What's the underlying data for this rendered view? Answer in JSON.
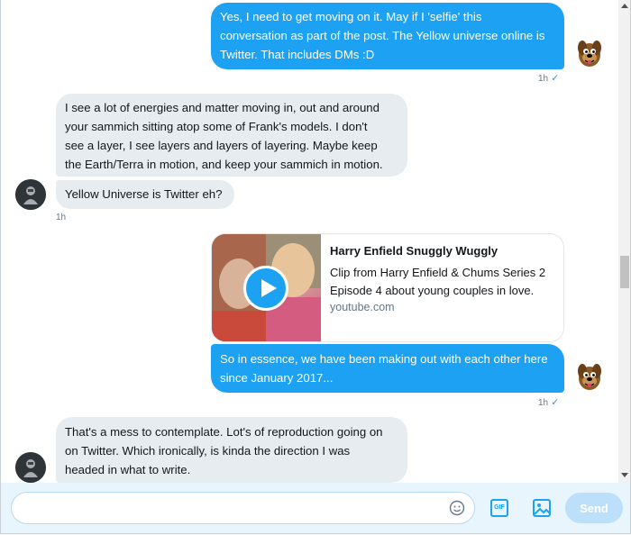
{
  "messages": {
    "m1": {
      "line1": "Yes, I need to get moving on it. May if I 'selfie' this",
      "line2": "conversation as part of the post. The Yellow universe online is",
      "line3": "Twitter. That includes DMs :D",
      "time": "1h",
      "check": "✓"
    },
    "m2": {
      "line1": "I see a lot of energies and matter moving in, out and around",
      "line2": "your sammich sitting atop some of Frank's models. I don't",
      "line3": "see a layer, I see layers and layers of layering. Maybe keep",
      "line4": "the Earth/Terra in motion, and keep your sammich in motion."
    },
    "m3": {
      "line1": "Yellow Universe is Twitter eh?",
      "time": "1h"
    },
    "card": {
      "title": "Harry Enfield Snuggly Wuggly",
      "desc": "Clip from Harry Enfield & Chums Series 2 Episode 4 about young couples in love.",
      "domain": "youtube.com"
    },
    "m4": {
      "line1": "So in essence, we have been making out with each other here",
      "line2": "since January 2017...",
      "time": "1h",
      "check": "✓"
    },
    "m5": {
      "line1": "That's a mess to contemplate. Lot's of reproduction going on",
      "line2": "on Twitter. Which ironically, is kinda the direction I was",
      "line3": "headed in what to write."
    }
  },
  "composer": {
    "placeholder": "",
    "gif_label": "GIF",
    "send_label": "Send"
  },
  "colors": {
    "accent": "#1da1f2",
    "incoming_bubble": "#e6ecf0",
    "composer_bg": "#e8f5fd",
    "send_disabled": "#bcdffa"
  },
  "icons": [
    "emoji-icon",
    "gif-icon",
    "image-icon",
    "play-icon",
    "checkmark-icon",
    "scooby-avatar",
    "dark-avatar"
  ]
}
